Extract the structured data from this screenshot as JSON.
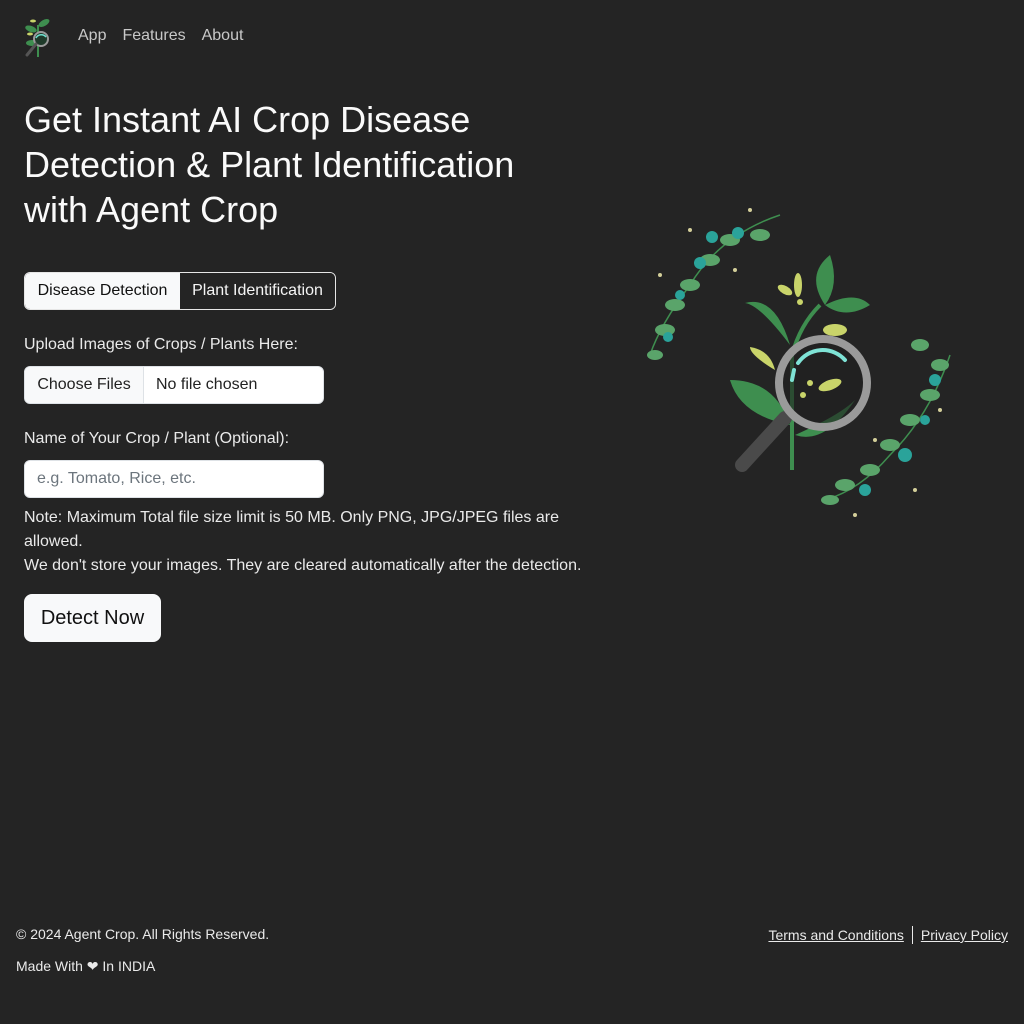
{
  "navbar": {
    "logo": "agent-crop-logo",
    "links": [
      {
        "label": "App"
      },
      {
        "label": "Features"
      },
      {
        "label": "About"
      }
    ]
  },
  "hero": {
    "title": "Get Instant AI Crop Disease Detection & Plant Identification with Agent Crop",
    "illustration": "plant-magnifier-illustration"
  },
  "form": {
    "mode_toggle": {
      "options": [
        {
          "label": "Disease Detection",
          "active": true
        },
        {
          "label": "Plant Identification",
          "active": false
        }
      ]
    },
    "upload_label": "Upload Images of Crops / Plants Here:",
    "file_input": {
      "button_label": "Choose Files",
      "status": "No file chosen"
    },
    "name_label": "Name of Your Crop / Plant (Optional):",
    "name_input": {
      "value": "",
      "placeholder": "e.g. Tomato, Rice, etc."
    },
    "note_line1": "Note: Maximum Total file size limit is 50 MB. Only PNG, JPG/JPEG files are allowed.",
    "note_line2": "We don't store your images. They are cleared automatically after the detection.",
    "submit_label": "Detect Now"
  },
  "footer": {
    "copyright": "© 2024 Agent Crop. All Rights Reserved.",
    "made_with": "Made With ❤ In INDIA",
    "links": [
      {
        "label": "Terms and Conditions"
      },
      {
        "label": "Privacy Policy"
      }
    ]
  },
  "colors": {
    "background": "#242424",
    "leaf_green": "#3e8e4f",
    "leaf_light": "#c9d46a",
    "accent_teal": "#2aa39a"
  }
}
